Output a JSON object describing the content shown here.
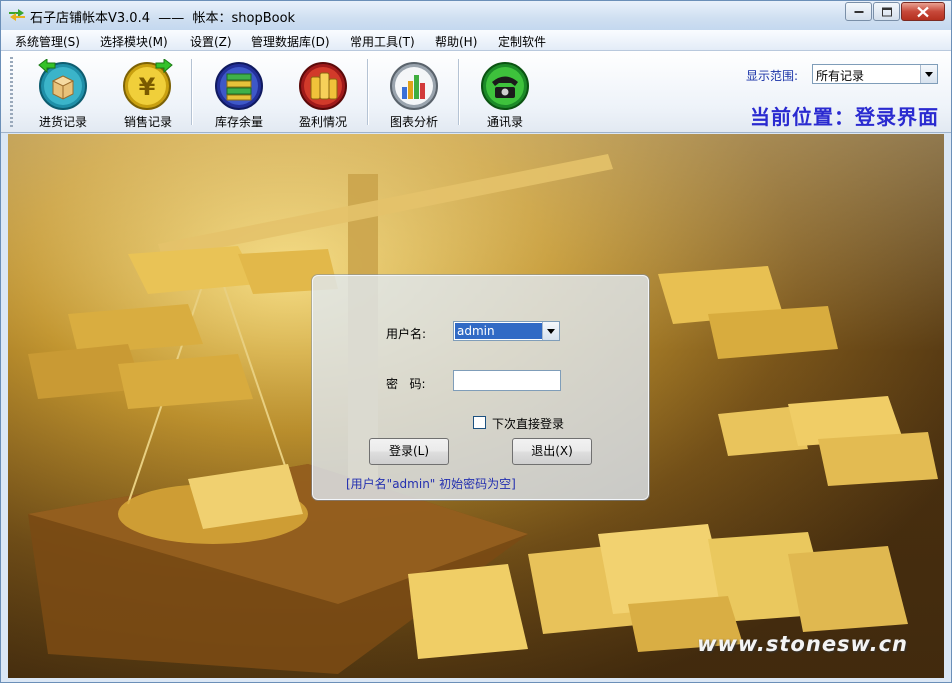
{
  "window": {
    "title": "石子店铺帐本V3.0.4  ——  帐本：shopBook"
  },
  "menu": {
    "items": [
      {
        "label": "系统管理(S)"
      },
      {
        "label": "选择模块(M)"
      },
      {
        "label": "设置(Z)"
      },
      {
        "label": "管理数据库(D)"
      },
      {
        "label": "常用工具(T)"
      },
      {
        "label": "帮助(H)"
      },
      {
        "label": "定制软件"
      }
    ]
  },
  "toolbar": {
    "buttons": [
      {
        "label": "进货记录",
        "icon": "box-arrow-in-icon"
      },
      {
        "label": "销售记录",
        "icon": "yen-arrow-out-icon"
      },
      {
        "label": "库存余量",
        "icon": "stack-icon"
      },
      {
        "label": "盈利情况",
        "icon": "coins-icon"
      },
      {
        "label": "图表分析",
        "icon": "bar-chart-icon"
      },
      {
        "label": "通讯录",
        "icon": "telephone-icon"
      }
    ],
    "range_label": "显示范围:",
    "range_value": "所有记录",
    "location": "当前位置：登录界面"
  },
  "login": {
    "username_label": "用户名:",
    "username_value": "admin",
    "password_label": "密   码:",
    "password_value": "",
    "auto_login_label": "下次直接登录",
    "auto_login_checked": false,
    "login_button": "登录(L)",
    "exit_button": "退出(X)",
    "hint": "[用户名\"admin\" 初始密码为空]"
  },
  "watermark": "www.stonesw.cn",
  "colors": {
    "location_text": "#2a2ad0",
    "hint_text": "#2430b0",
    "selection": "#316ac5"
  }
}
